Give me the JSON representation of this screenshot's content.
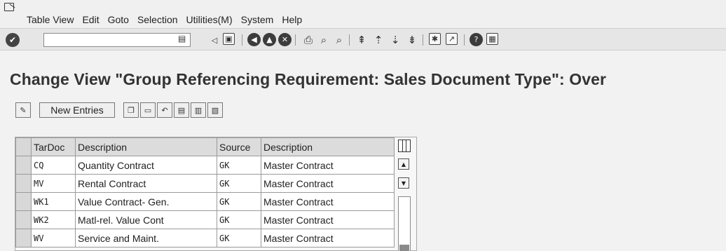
{
  "menu": {
    "items": [
      {
        "label": "Table View"
      },
      {
        "label": "Edit"
      },
      {
        "label": "Goto"
      },
      {
        "label": "Selection"
      },
      {
        "label": "Utilities(M)"
      },
      {
        "label": "System"
      },
      {
        "label": "Help"
      }
    ]
  },
  "toolbar": {
    "command_field_value": "",
    "icons": [
      "check-icon",
      "back-icon",
      "exit-icon",
      "cancel-icon",
      "print-icon",
      "find-icon",
      "find-next-icon",
      "first-page-icon",
      "previous-page-icon",
      "next-page-icon",
      "last-page-icon",
      "create-session-icon",
      "shortcut-icon",
      "help-icon",
      "layout-icon"
    ]
  },
  "title": "Change View \"Group Referencing Requirement: Sales Document Type\": Over",
  "app_toolbar": {
    "new_entries_label": "New Entries"
  },
  "table": {
    "headers": [
      "TarDoc",
      "Description",
      "Source",
      "Description"
    ],
    "rows": [
      {
        "tardoc": "CQ",
        "description": "Quantity Contract",
        "source": "GK",
        "source_description": "Master Contract"
      },
      {
        "tardoc": "MV",
        "description": "Rental Contract",
        "source": "GK",
        "source_description": "Master Contract"
      },
      {
        "tardoc": "WK1",
        "description": "Value Contract- Gen.",
        "source": "GK",
        "source_description": "Master Contract"
      },
      {
        "tardoc": "WK2",
        "description": "Matl-rel. Value Cont",
        "source": "GK",
        "source_description": "Master Contract"
      },
      {
        "tardoc": "WV",
        "description": "Service and Maint.",
        "source": "GK",
        "source_description": "Master Contract"
      }
    ]
  }
}
